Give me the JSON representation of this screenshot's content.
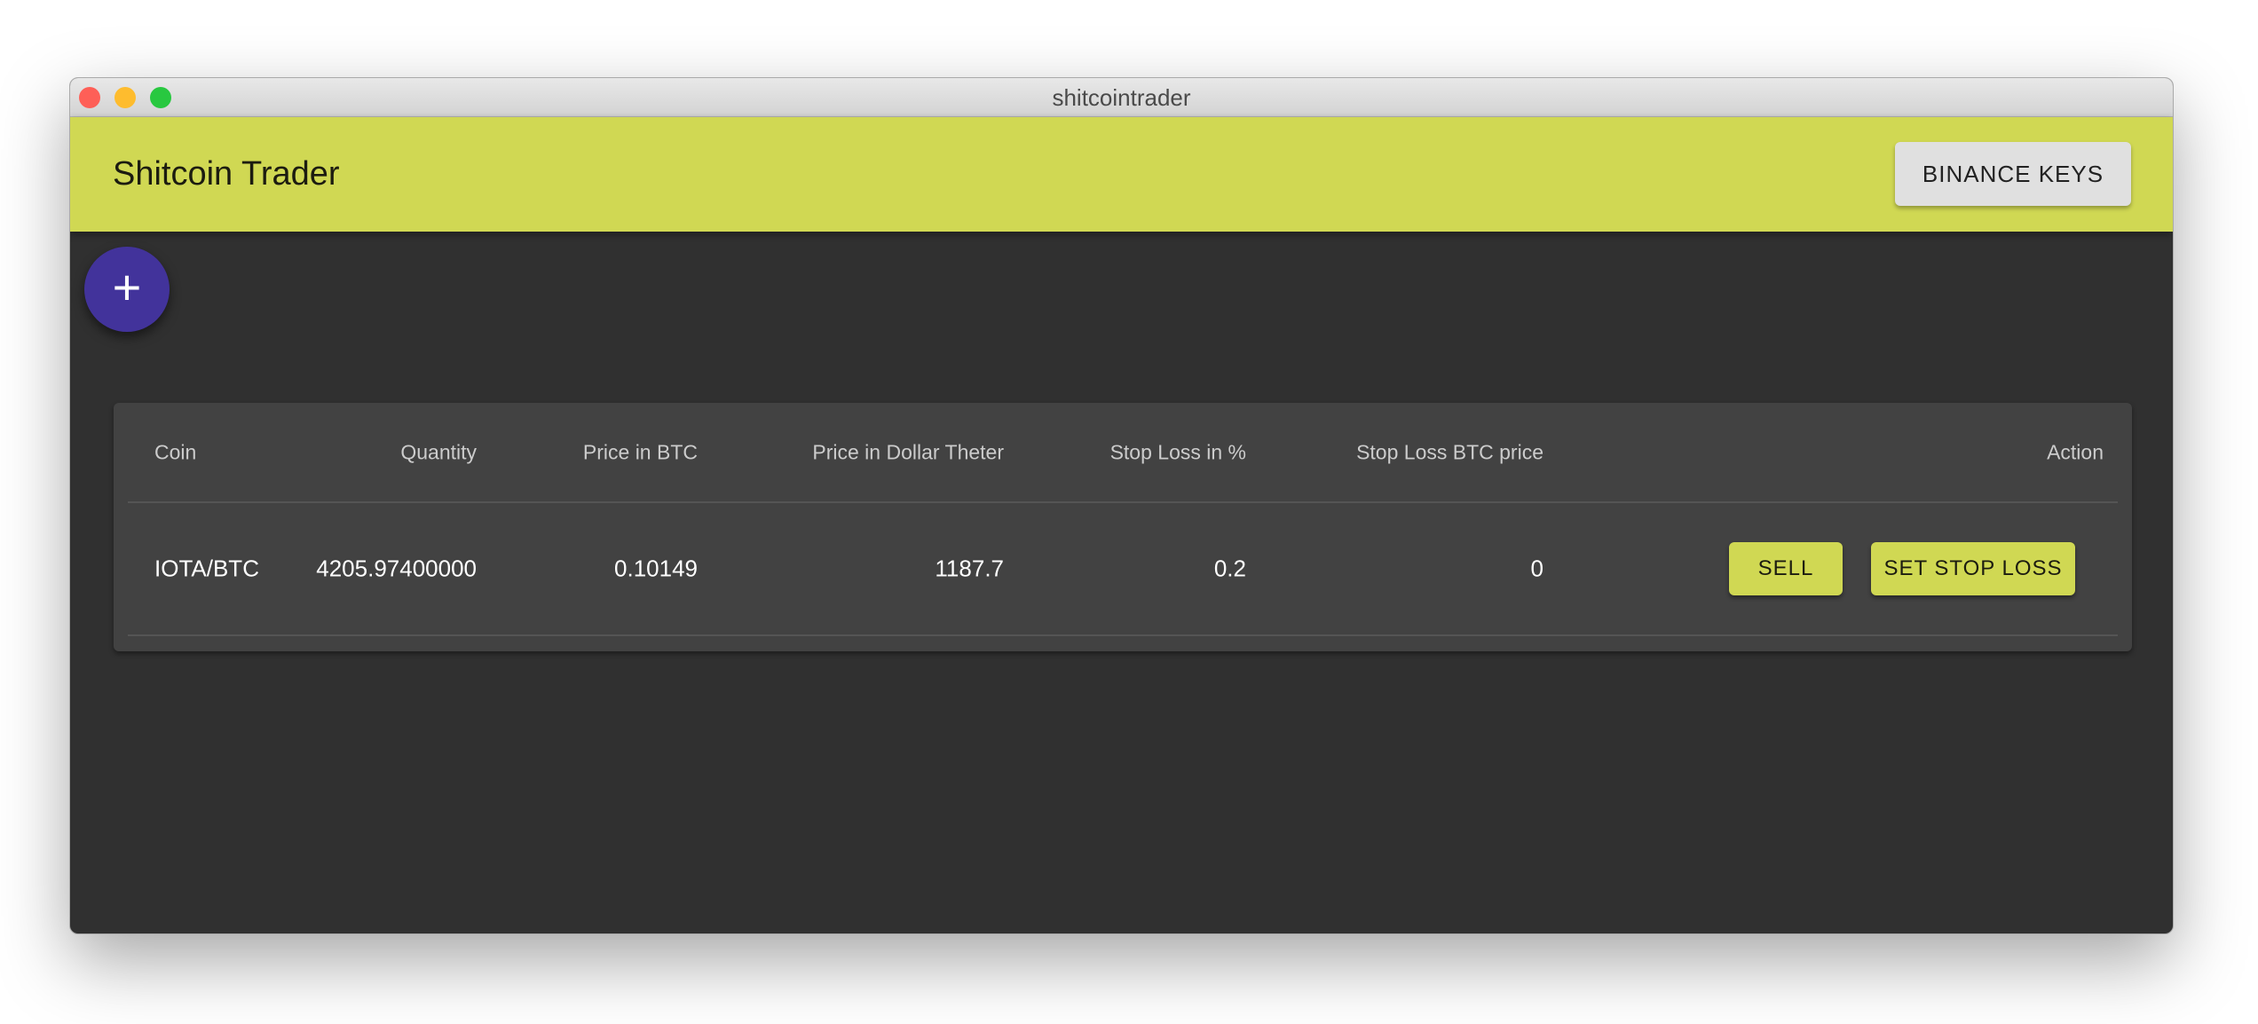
{
  "window": {
    "title": "shitcointrader"
  },
  "appbar": {
    "title": "Shitcoin Trader",
    "keys_button": "BINANCE KEYS"
  },
  "fab": {
    "icon": "+"
  },
  "table": {
    "headers": [
      "Coin",
      "Quantity",
      "Price in BTC",
      "Price in Dollar Theter",
      "Stop Loss in %",
      "Stop Loss BTC price",
      "Action"
    ],
    "rows": [
      {
        "coin": "IOTA/BTC",
        "quantity": "4205.97400000",
        "price_btc": "0.10149",
        "price_usdt": "1187.7",
        "stop_loss_pct": "0.2",
        "stop_loss_btc": "0",
        "sell": "SELL",
        "set_stop_loss": "SET STOP LOSS"
      }
    ]
  },
  "colors": {
    "accent": "#d0d853",
    "fab": "#42339b",
    "background": "#303030",
    "card": "#424242"
  }
}
